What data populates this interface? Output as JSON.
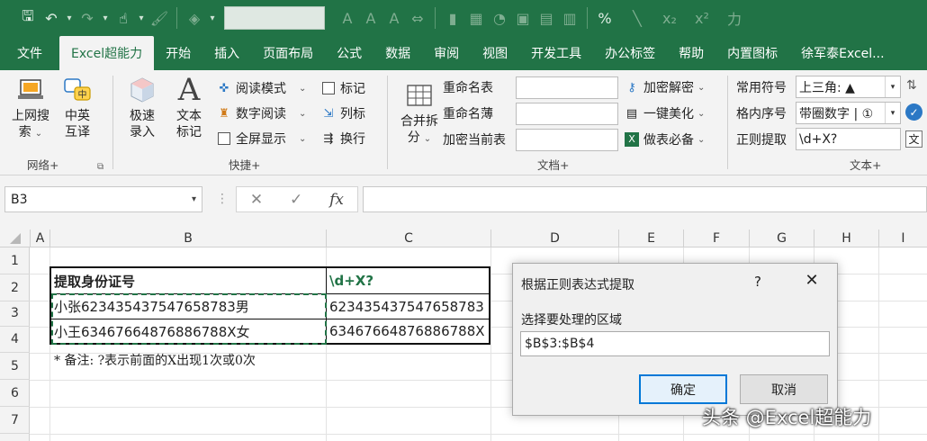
{
  "quick_access": {
    "icons": [
      "save-icon",
      "undo-icon",
      "redo-icon",
      "touch-mode-icon",
      "format-brush-icon",
      "fill-color-icon",
      "font-size-up-icon",
      "font-color-icon",
      "font-size-down-icon",
      "fit-icon",
      "chart-icon",
      "table-icon",
      "pie-icon",
      "camera-icon",
      "format-icon",
      "grid-icon",
      "percent-icon",
      "line-icon",
      "subscript-icon",
      "superscript-icon",
      "power-icon"
    ],
    "percent_label": "%",
    "subscript_label": "x₂",
    "superscript_label": "x²"
  },
  "tabs": [
    {
      "label": "文件",
      "active": false
    },
    {
      "label": "Excel超能力",
      "active": true
    },
    {
      "label": "开始",
      "active": false
    },
    {
      "label": "插入",
      "active": false
    },
    {
      "label": "页面布局",
      "active": false
    },
    {
      "label": "公式",
      "active": false
    },
    {
      "label": "数据",
      "active": false
    },
    {
      "label": "审阅",
      "active": false
    },
    {
      "label": "视图",
      "active": false
    },
    {
      "label": "开发工具",
      "active": false
    },
    {
      "label": "办公标签",
      "active": false
    },
    {
      "label": "帮助",
      "active": false
    },
    {
      "label": "内置图标",
      "active": false
    },
    {
      "label": "徐军泰Excel...",
      "active": false
    }
  ],
  "ribbon": {
    "network": {
      "label": "网络+",
      "btn1_line1": "上网搜",
      "btn1_line2": "索",
      "btn2_line1": "中英",
      "btn2_line2": "互译",
      "translate_icon_text": "中"
    },
    "quick": {
      "label": "快捷+",
      "btn1_line1": "极速",
      "btn1_line2": "录入",
      "btn2_line1": "文本",
      "btn2_line2": "标记",
      "read_mode": "阅读模式",
      "digit_read": "数字阅读",
      "fullscreen": "全屏显示",
      "mark": "标记",
      "column_mark": "列标",
      "wrap": "换行"
    },
    "document": {
      "label": "文档+",
      "merge_line1": "合并拆",
      "merge_line2": "分",
      "rename_sheet": "重命名表",
      "rename_book": "重命名薄",
      "encrypt_current": "加密当前表",
      "encrypt_decrypt": "加密解密",
      "beautify": "一键美化",
      "essential": "做表必备"
    },
    "text": {
      "label": "文本+",
      "common_symbol_label": "常用符号",
      "common_symbol_value": "上三角: ▲",
      "list_order_label": "格内序号",
      "list_order_value": "带圈数字 | ①",
      "regex_label": "正则提取",
      "regex_value": "\\d+X?",
      "text_icon": "文"
    }
  },
  "formula_bar": {
    "name_box": "B3",
    "cancel": "✕",
    "confirm": "✓",
    "fx": "fx"
  },
  "columns": [
    "A",
    "B",
    "C",
    "D",
    "E",
    "F",
    "G",
    "H",
    "I"
  ],
  "rows": [
    "1",
    "2",
    "3",
    "4",
    "5",
    "6",
    "7"
  ],
  "table": {
    "header_b": "提取身份证号",
    "header_c": "\\d+X?",
    "r3_b": "小张623435437547658783男",
    "r3_c": "623435437547658783",
    "r4_b": "小王634676648768867​88X女",
    "r4_c": "634676648768867​88X"
  },
  "note": "* 备注: ?表示前面的X出现1次或0次",
  "dialog": {
    "title": "根据正则表达式提取",
    "help": "?",
    "close": "✕",
    "prompt": "选择要处理的区域",
    "range_value": "$B$3:$B$4",
    "ok": "确定",
    "cancel": "取消"
  },
  "watermark": "头条 @Excel超能力",
  "colors": {
    "excel_green": "#217346",
    "accent_blue": "#0078d7",
    "marching_ants": "#217346"
  }
}
